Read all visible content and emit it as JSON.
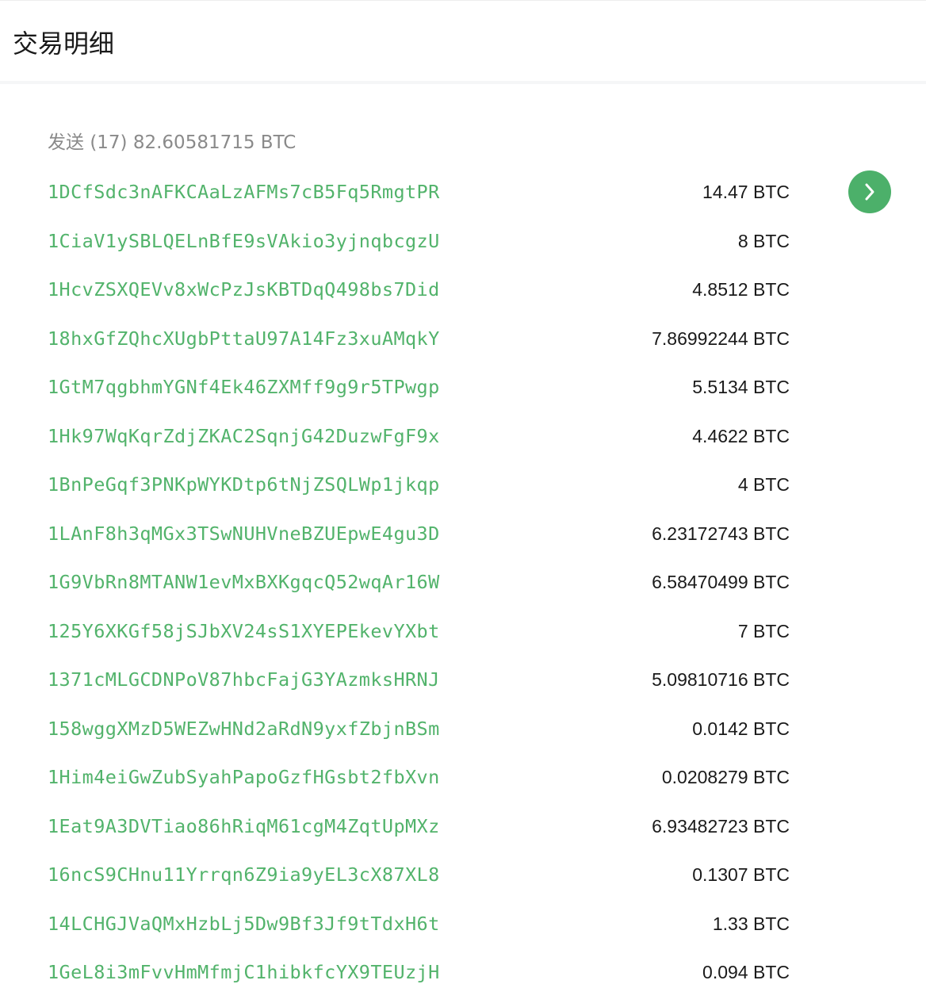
{
  "header": {
    "title": "交易明细"
  },
  "summary": {
    "label": "发送",
    "count": "(17)",
    "total": "82.60581715 BTC"
  },
  "colors": {
    "address": "#52b36b",
    "accent": "#4cb06a",
    "muted": "#8a8a8a"
  },
  "next_button": {
    "icon": "chevron-right-icon"
  },
  "outputs": [
    {
      "address": "1DCfSdc3nAFKCAaLzAFMs7cB5Fq5RmgtPR",
      "amount": "14.47 BTC"
    },
    {
      "address": "1CiaV1ySBLQELnBfE9sVAkio3yjnqbcgzU",
      "amount": "8 BTC"
    },
    {
      "address": "1HcvZSXQEVv8xWcPzJsKBTDqQ498bs7Did",
      "amount": "4.8512 BTC"
    },
    {
      "address": "18hxGfZQhcXUgbPttaU97A14Fz3xuAMqkY",
      "amount": "7.86992244 BTC"
    },
    {
      "address": "1GtM7qgbhmYGNf4Ek46ZXMff9g9r5TPwgp",
      "amount": "5.5134 BTC"
    },
    {
      "address": "1Hk97WqKqrZdjZKAC2SqnjG42DuzwFgF9x",
      "amount": "4.4622 BTC"
    },
    {
      "address": "1BnPeGqf3PNKpWYKDtp6tNjZSQLWp1jkqp",
      "amount": "4 BTC"
    },
    {
      "address": "1LAnF8h3qMGx3TSwNUHVneBZUEpwE4gu3D",
      "amount": "6.23172743 BTC"
    },
    {
      "address": "1G9VbRn8MTANW1evMxBXKgqcQ52wqAr16W",
      "amount": "6.58470499 BTC"
    },
    {
      "address": "125Y6XKGf58jSJbXV24sS1XYEPEkevYXbt",
      "amount": "7 BTC"
    },
    {
      "address": "1371cMLGCDNPoV87hbcFajG3YAzmksHRNJ",
      "amount": "5.09810716 BTC"
    },
    {
      "address": "158wggXMzD5WEZwHNd2aRdN9yxfZbjnBSm",
      "amount": "0.0142 BTC"
    },
    {
      "address": "1Him4eiGwZubSyahPapoGzfHGsbt2fbXvn",
      "amount": "0.0208279 BTC"
    },
    {
      "address": "1Eat9A3DVTiao86hRiqM61cgM4ZqtUpMXz",
      "amount": "6.93482723 BTC"
    },
    {
      "address": "16ncS9CHnu11Yrrqn6Z9ia9yEL3cX87XL8",
      "amount": "0.1307 BTC"
    },
    {
      "address": "14LCHGJVaQMxHzbLj5Dw9Bf3Jf9tTdxH6t",
      "amount": "1.33 BTC"
    },
    {
      "address": "1GeL8i3mFvvHmMfmjC1hibkfcYX9TEUzjH",
      "amount": "0.094 BTC"
    }
  ]
}
